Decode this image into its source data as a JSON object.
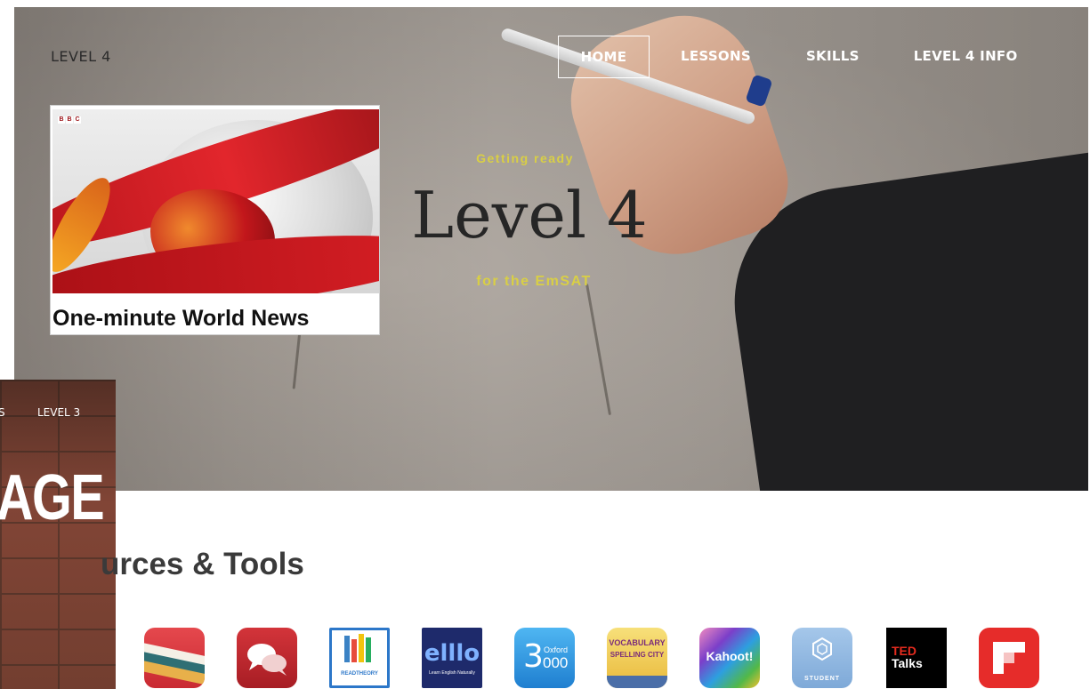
{
  "hero": {
    "site_title": "LEVEL 4",
    "nav": [
      "HOME",
      "LESSONS",
      "SKILLS",
      "LEVEL 4 INFO"
    ],
    "kicker": "Getting ready",
    "title": "Level 4",
    "subtitle": "for the EmSAT"
  },
  "news_card": {
    "caption": "One-minute World News",
    "logo_letters": [
      "B",
      "B",
      "C"
    ]
  },
  "background_window": {
    "nav_prev": "S",
    "nav_level": "LEVEL 3",
    "big_text": "AGE"
  },
  "section": {
    "title": "urces & Tools"
  },
  "tools": [
    {
      "name": "stripes-app-icon"
    },
    {
      "name": "chat-bubbles-icon"
    },
    {
      "name": "readtheory-icon",
      "label": "READTHEORY"
    },
    {
      "name": "elllo-icon",
      "label": "elllo",
      "sub": "Learn English Naturally"
    },
    {
      "name": "oxford-3000-icon",
      "label": "3",
      "sub_top": "Oxford",
      "sub_bottom": "000"
    },
    {
      "name": "spelling-city-icon",
      "label_top": "VOCABULARY",
      "label_bottom": "SPELLING CITY"
    },
    {
      "name": "kahoot-icon",
      "label": "Kahoot!"
    },
    {
      "name": "student-hex-icon",
      "label": "STUDENT"
    },
    {
      "name": "ted-talks-icon",
      "label_top": "TED",
      "label_bottom": "Talks"
    },
    {
      "name": "flipboard-icon"
    }
  ],
  "colors": {
    "accent_yellow": "#d9cf45",
    "nav_text": "#ffffff",
    "ted_red": "#e62b1e"
  }
}
